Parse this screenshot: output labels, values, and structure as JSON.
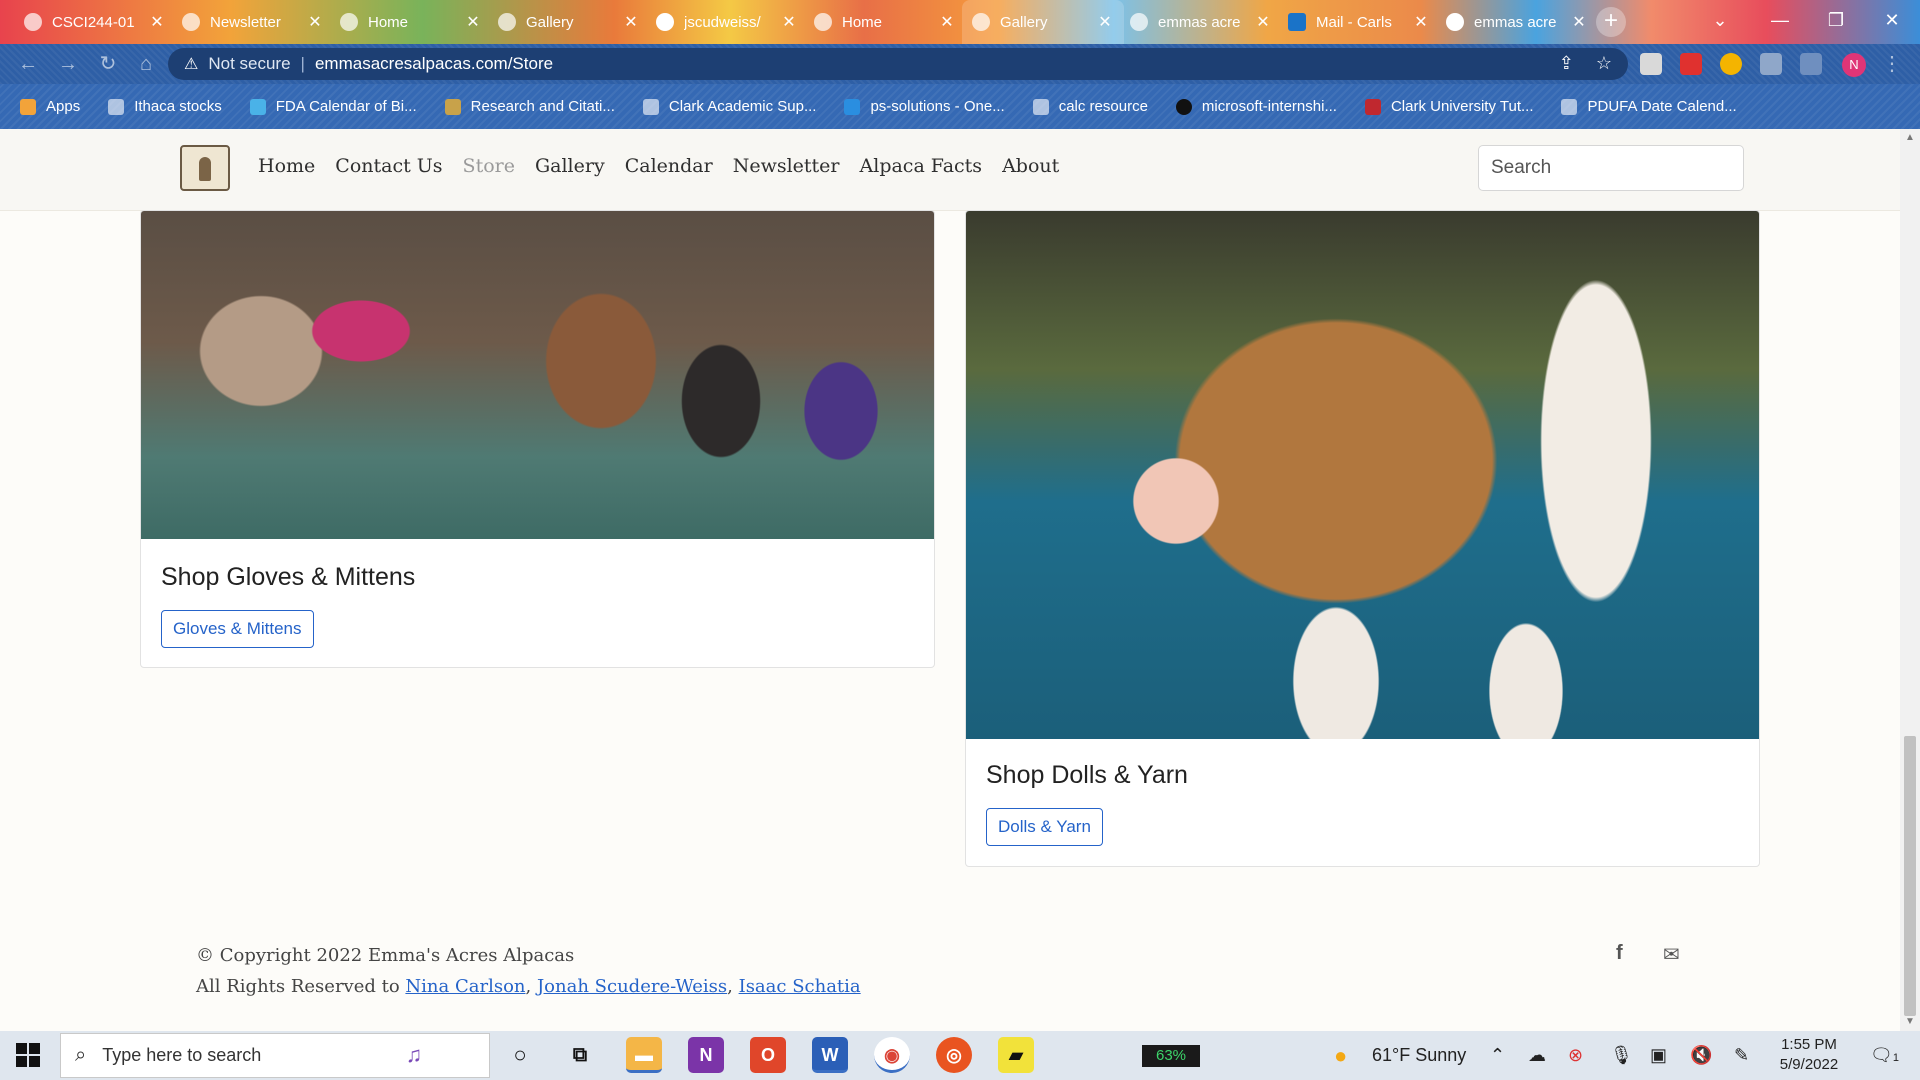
{
  "browser": {
    "tabs": [
      {
        "label": "CSCI244-01",
        "active": false
      },
      {
        "label": "Newsletter",
        "active": false
      },
      {
        "label": "Home",
        "active": false
      },
      {
        "label": "Gallery",
        "active": false
      },
      {
        "label": "jscudweiss/",
        "active": false
      },
      {
        "label": "Home",
        "active": false
      },
      {
        "label": "Gallery",
        "active": true
      },
      {
        "label": "emmas acre",
        "active": false
      },
      {
        "label": "Mail - Carls",
        "active": false
      },
      {
        "label": "emmas acre",
        "active": false
      }
    ],
    "security_label": "Not secure",
    "url": "emmasacresalpacas.com/Store",
    "bookmarks": [
      "Apps",
      "Ithaca stocks",
      "FDA Calendar of Bi...",
      "Research and Citati...",
      "Clark Academic Sup...",
      "ps-solutions - One...",
      "calc resource",
      "microsoft-internshi...",
      "Clark University Tut...",
      "PDUFA Date Calend..."
    ],
    "profile_initial": "N"
  },
  "site": {
    "nav": [
      "Home",
      "Contact Us",
      "Store",
      "Gallery",
      "Calendar",
      "Newsletter",
      "Alpaca Facts",
      "About"
    ],
    "active_nav": "Store",
    "search_placeholder": "Search",
    "cards": [
      {
        "title": "Shop Gloves & Mittens",
        "button": "Gloves & Mittens"
      },
      {
        "title": "Shop Dolls & Yarn",
        "button": "Dolls & Yarn"
      }
    ],
    "footer": {
      "copyright": "© Copyright 2022 Emma's Acres Alpacas",
      "rights_prefix": "All Rights Reserved to",
      "authors": [
        "Nina Carlson",
        "Jonah Scudere-Weiss",
        "Isaac Schatia"
      ],
      "icons": [
        "facebook-icon",
        "mail-icon"
      ]
    }
  },
  "taskbar": {
    "search_placeholder": "Type here to search",
    "battery": "63%",
    "weather": "61°F  Sunny",
    "time": "1:55 PM",
    "date": "5/9/2022",
    "notifications": "1"
  }
}
